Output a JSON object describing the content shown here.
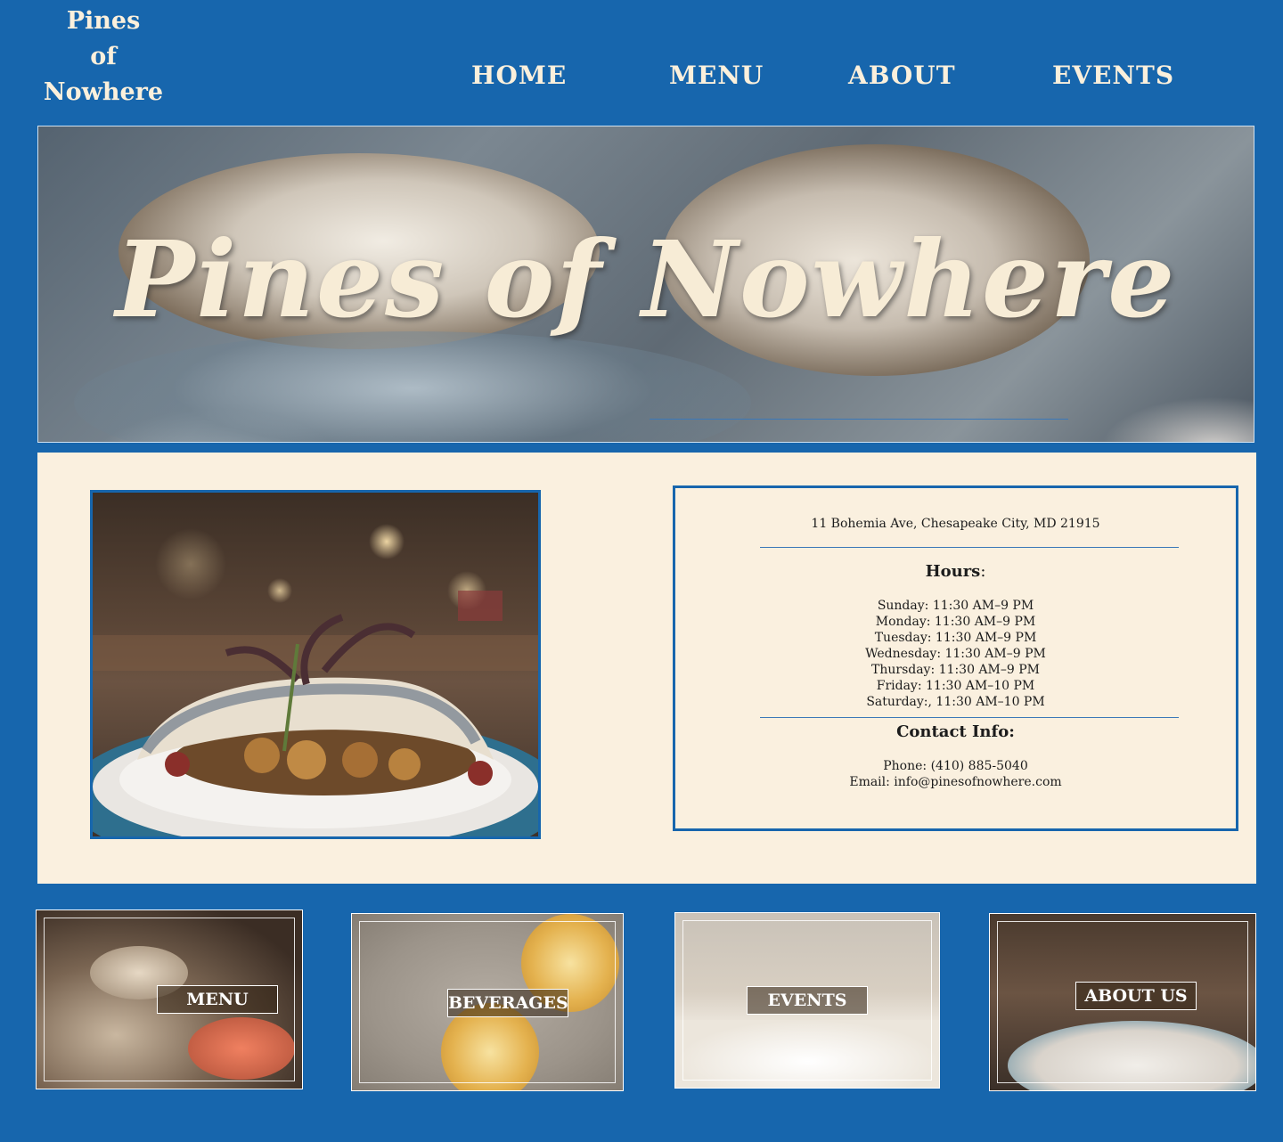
{
  "header": {
    "logo_line1": "Pines",
    "logo_line2": "of",
    "logo_line3": "Nowhere",
    "nav": [
      "HOME",
      "MENU",
      "ABOUT",
      "EVENTS"
    ]
  },
  "hero": {
    "title": "Pines of Nowhere"
  },
  "info": {
    "address": "11 Bohemia Ave, Chesapeake City, MD 21915",
    "hours_heading": "Hours",
    "hours_colon": ":",
    "hours": [
      "Sunday: 11:30 AM–9 PM",
      "Monday: 11:30 AM–9 PM",
      "Tuesday: 11:30 AM–9 PM",
      "Wednesday: 11:30 AM–9 PM",
      "Thursday:  11:30 AM–9 PM",
      "Friday: 11:30 AM–10 PM",
      "Saturday:, 11:30 AM–10 PM"
    ],
    "contact_heading": "Contact Info:",
    "phone": "Phone: (410) 885-5040",
    "email": "Email: info@pinesofnowhere.com"
  },
  "tiles": [
    {
      "label": "MENU"
    },
    {
      "label": "BEVERAGES"
    },
    {
      "label": "EVENTS"
    },
    {
      "label": "ABOUT US"
    }
  ],
  "colors": {
    "background": "#1766ad",
    "panel": "#faf0df",
    "cream_text": "#fbf0dc"
  }
}
